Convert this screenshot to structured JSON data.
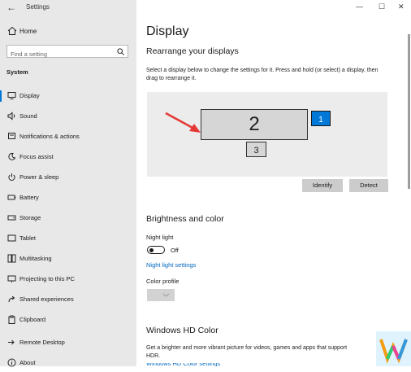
{
  "window": {
    "app_title": "Settings",
    "minimize": "—",
    "maximize": "☐",
    "close": "✕"
  },
  "sidebar": {
    "home_label": "Home",
    "search_placeholder": "Find a setting",
    "section": "System",
    "items": [
      {
        "label": "Display",
        "icon": "monitor-icon"
      },
      {
        "label": "Sound",
        "icon": "speaker-icon"
      },
      {
        "label": "Notifications & actions",
        "icon": "notification-icon"
      },
      {
        "label": "Focus assist",
        "icon": "moon-icon"
      },
      {
        "label": "Power & sleep",
        "icon": "power-icon"
      },
      {
        "label": "Battery",
        "icon": "battery-icon"
      },
      {
        "label": "Storage",
        "icon": "storage-icon"
      },
      {
        "label": "Tablet",
        "icon": "tablet-icon"
      },
      {
        "label": "Multitasking",
        "icon": "multitasking-icon"
      },
      {
        "label": "Projecting to this PC",
        "icon": "projector-icon"
      },
      {
        "label": "Shared experiences",
        "icon": "share-icon"
      },
      {
        "label": "Clipboard",
        "icon": "clipboard-icon"
      },
      {
        "label": "Remote Desktop",
        "icon": "remote-desktop-icon"
      },
      {
        "label": "About",
        "icon": "info-icon"
      }
    ]
  },
  "main": {
    "title": "Display",
    "rearrange": {
      "heading": "Rearrange your displays",
      "description": "Select a display below to change the settings for it. Press and hold (or select) a display, then drag to rearrange it.",
      "monitors": [
        "2",
        "1",
        "3"
      ],
      "identify_label": "Identify",
      "detect_label": "Detect"
    },
    "brightness": {
      "heading": "Brightness and color",
      "night_light_label": "Night light",
      "night_light_state": "Off",
      "night_light_settings_link": "Night light settings",
      "color_profile_label": "Color profile"
    },
    "hdr": {
      "heading": "Windows HD Color",
      "description": "Get a brighter and more vibrant picture for videos, games and apps that support HDR.",
      "link_partial": "Windows HD Color settings"
    }
  },
  "colors": {
    "accent": "#0078d7",
    "sidebar_bg": "#e8e8e8",
    "link": "#0067c0"
  }
}
